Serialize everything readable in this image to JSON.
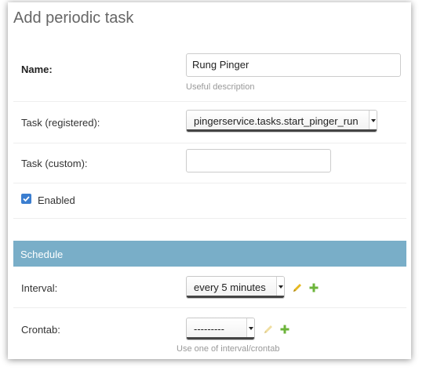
{
  "page": {
    "title": "Add periodic task"
  },
  "name_field": {
    "label": "Name:",
    "value": "Rung Pinger",
    "help": "Useful description"
  },
  "task_registered": {
    "label": "Task (registered):",
    "selected": "pingerservice.tasks.start_pinger_run"
  },
  "task_custom": {
    "label": "Task (custom):",
    "value": ""
  },
  "enabled": {
    "label": "Enabled",
    "checked": true
  },
  "schedule": {
    "header": "Schedule",
    "interval": {
      "label": "Interval:",
      "selected": "every 5 minutes",
      "edit_icon": "pencil-icon",
      "add_icon": "plus-icon"
    },
    "crontab": {
      "label": "Crontab:",
      "selected": "---------",
      "edit_icon": "pencil-icon",
      "add_icon": "plus-icon",
      "help": "Use one of interval/crontab"
    }
  },
  "colors": {
    "section_header_bg": "#79aec8",
    "checkbox": "#3b7ed0",
    "pencil": "#e6b820",
    "pencil_disabled": "#f0dea0",
    "plus": "#6cb43a"
  }
}
